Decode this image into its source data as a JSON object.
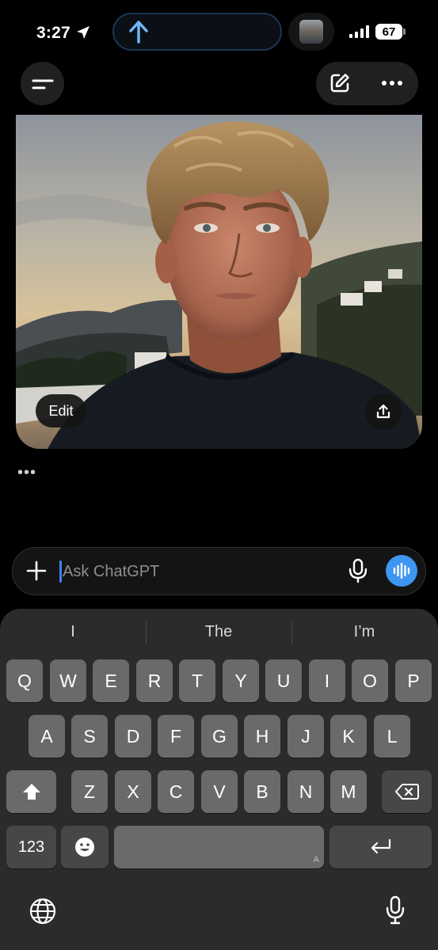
{
  "status_bar": {
    "time": "3:27",
    "battery": "67"
  },
  "icons": {
    "location": "location-arrow-icon",
    "island_upload": "upload-arrow-icon",
    "signal": "cellular-signal-icon",
    "menu": "hamburger-menu-icon",
    "compose": "edit-pencil-icon",
    "more": "ellipsis-icon",
    "share": "share-icon",
    "plus": "plus-icon",
    "mic": "microphone-icon",
    "voice": "voice-waveform-icon",
    "shift": "shift-icon",
    "backspace": "backspace-icon",
    "emoji": "emoji-icon",
    "return": "return-icon",
    "globe": "globe-icon",
    "dictation": "dictation-mic-icon"
  },
  "image_card": {
    "edit_label": "Edit"
  },
  "chat": {
    "typing_indicator": "•••"
  },
  "composer": {
    "placeholder": "Ask ChatGPT",
    "value": ""
  },
  "keyboard": {
    "suggestions": [
      "I",
      "The",
      "I’m"
    ],
    "row1": [
      "Q",
      "W",
      "E",
      "R",
      "T",
      "Y",
      "U",
      "I",
      "O",
      "P"
    ],
    "row2": [
      "A",
      "S",
      "D",
      "F",
      "G",
      "H",
      "J",
      "K",
      "L"
    ],
    "row3": [
      "Z",
      "X",
      "C",
      "V",
      "B",
      "N",
      "M"
    ],
    "numbers_label": "123",
    "space_hint": "A"
  },
  "colors": {
    "accent": "#3d96f0",
    "caret": "#3c82f6",
    "key": "#6a6a6a",
    "key_dark": "#474747",
    "keyboard_bg": "#2b2b2b"
  }
}
